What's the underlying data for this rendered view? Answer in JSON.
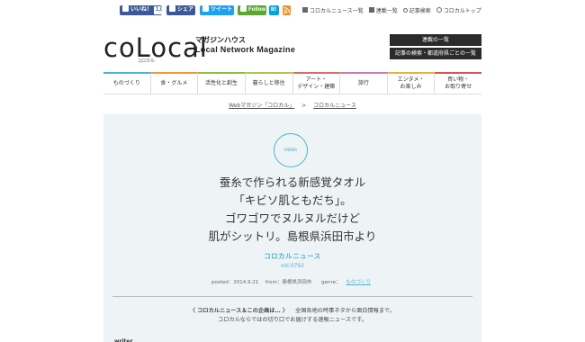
{
  "share": {
    "facebook_like": "いいね！",
    "facebook_count": "1,095",
    "facebook_share": "シェア",
    "tweet": "ツイート",
    "follow": "Follow",
    "hatena": "B!",
    "rss_icon": "rss-icon"
  },
  "top_links": {
    "news_list": "コロカルニュース一覧",
    "series_list": "連載一覧",
    "article_search": "記事検索",
    "home": "コロカルトップ"
  },
  "header": {
    "logo": "coLocal",
    "logo_sub": "コロカル",
    "magazine_jp": "マガジンハウス",
    "magazine_en": "Local Network Magazine",
    "button_series": "連載の一覧",
    "button_search": "記事の検索・都道府県ごとの一覧"
  },
  "nav": [
    {
      "label": "ものづくり",
      "color": "#4bb3d3"
    },
    {
      "label": "食・グルメ",
      "color": "#e99a3a"
    },
    {
      "label": "活性化と創生",
      "color": "#8bbf4a"
    },
    {
      "label": "暮らしと移住",
      "color": "#a7c84c"
    },
    {
      "label": "アート・\nデザイン・建築",
      "color": "#d96b6b"
    },
    {
      "label": "旅行",
      "color": "#c77ab8"
    },
    {
      "label": "エンタメ・\nお楽しみ",
      "color": "#e3b43a"
    },
    {
      "label": "買い物・\nお取り寄せ",
      "color": "#d75454"
    }
  ],
  "breadcrumb": {
    "home": "Webマガジン「コロカル」",
    "sep": ">",
    "current": "コロカルニュース"
  },
  "article": {
    "badge": "news",
    "title_lines": [
      "蚕糸で作られる新感覚タオル",
      "「キビソ肌ともだち」。",
      "ゴワゴワでヌルヌルだけど",
      "肌がシットリ。島根県浜田市より"
    ],
    "series": "コロカルニュース",
    "vol": "vol.0792",
    "posted": "posted：2014.9.21",
    "from": "from：島根県浜田市",
    "genre_label": "genre：",
    "genre_value": "ものづくり",
    "desc_title": "〈 コロカルニュース＆この企画は… 〉",
    "desc_line1": "全国各地の時事ネタから面白情報まで。",
    "desc_line2": "コロカルならではの切り口でお届けする速報ニュースです。",
    "cut_text": "writer"
  },
  "colors": {
    "accent": "#4bb3d3",
    "panel_bg": "#eef3f5",
    "dark_button": "#2b2b2b"
  }
}
